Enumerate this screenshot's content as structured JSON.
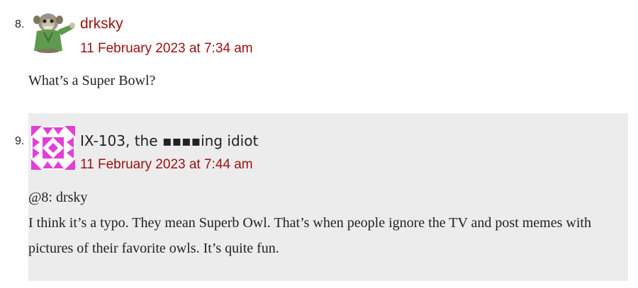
{
  "comments": [
    {
      "number": "8.",
      "author": "drksky",
      "avatar_icon": "monkey-avatar-icon",
      "date": "11 February 2023 at 7:34 am",
      "paragraphs": [
        "What’s a Super Bowl?"
      ]
    },
    {
      "number": "9.",
      "author": "IX-103, the ▪▪▪▪ing idiot",
      "avatar_icon": "identicon-avatar-icon",
      "avatar_color": "#e040d8",
      "date": "11 February 2023 at 7:44 am",
      "paragraphs": [
        "@8: drsky",
        "I think it’s a typo. They mean Superb Owl. That’s when people ignore the TV and post memes with pictures of their favorite owls. It’s quite fun."
      ]
    }
  ],
  "colors": {
    "link": "#9b1010",
    "highlight_bg": "#ececec"
  }
}
